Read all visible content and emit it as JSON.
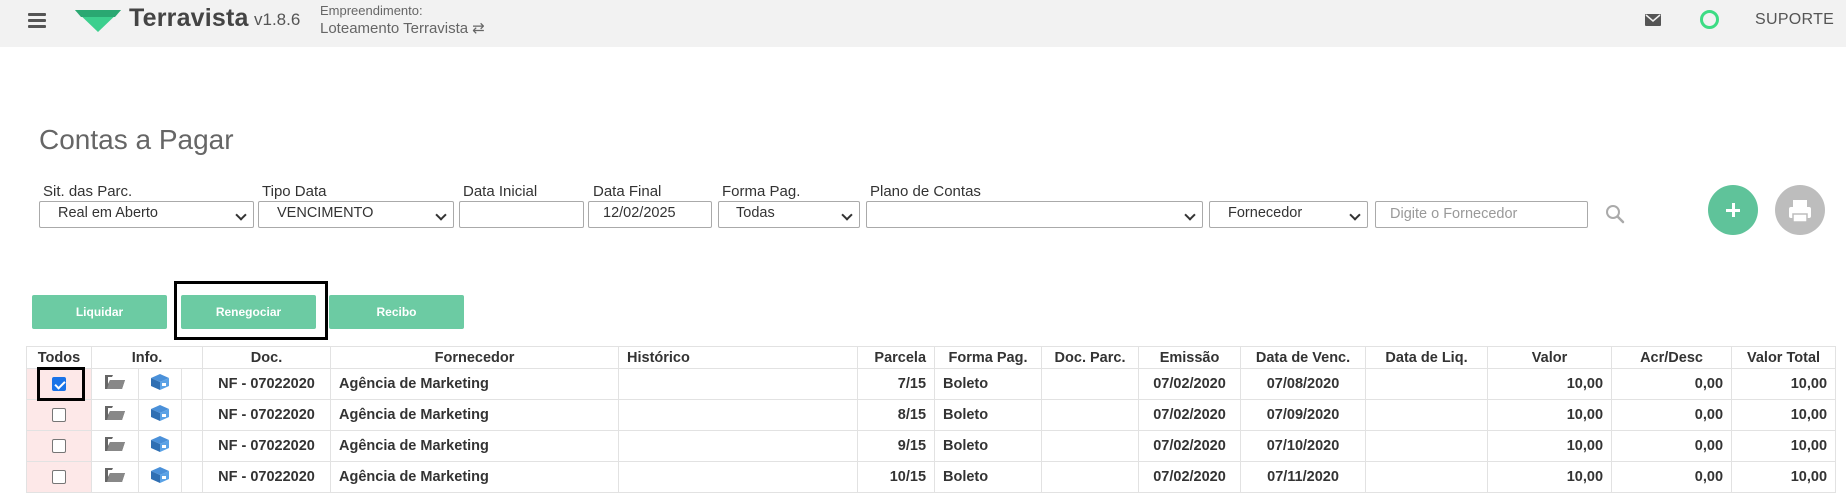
{
  "header": {
    "brand": "Terravista",
    "version": "v1.8.6",
    "empreendimento_label": "Empreendimento:",
    "empreendimento_value": "Loteamento Terravista ⇄",
    "support_label": "SUPORTE",
    "brand_color": "#3ccf8e"
  },
  "page": {
    "title": "Contas a Pagar"
  },
  "filters": {
    "situacao": {
      "label": "Sit. das Parc.",
      "value": "Real em Aberto"
    },
    "tipo_data": {
      "label": "Tipo Data",
      "value": "VENCIMENTO"
    },
    "data_inicial": {
      "label": "Data Inicial",
      "value": ""
    },
    "data_final": {
      "label": "Data Final",
      "value": "12/02/2025"
    },
    "forma_pag": {
      "label": "Forma Pag.",
      "value": "Todas"
    },
    "plano_contas": {
      "label": "Plano de Contas",
      "value": ""
    },
    "fornecedor_select": {
      "value": "Fornecedor"
    },
    "fornecedor_search": {
      "placeholder": "Digite o Fornecedor"
    }
  },
  "actions": {
    "liquidar": "Liquidar",
    "renegociar": "Renegociar",
    "recibo": "Recibo"
  },
  "table": {
    "headers": {
      "todos": "Todos",
      "info": "Info.",
      "doc": "Doc.",
      "fornecedor": "Fornecedor",
      "historico": "Histórico",
      "parcela": "Parcela",
      "forma_pag": "Forma Pag.",
      "doc_parc": "Doc. Parc.",
      "emissao": "Emissão",
      "data_venc": "Data de Venc.",
      "data_liq": "Data de Liq.",
      "valor": "Valor",
      "acr_desc": "Acr/Desc",
      "valor_total": "Valor Total"
    },
    "rows": [
      {
        "checked": true,
        "doc": "NF - 07022020",
        "fornecedor": "Agência de Marketing",
        "historico": "",
        "parcela": "7/15",
        "forma_pag": "Boleto",
        "doc_parc": "",
        "emissao": "07/02/2020",
        "venc": "07/08/2020",
        "liq": "",
        "valor": "10,00",
        "acr": "0,00",
        "total": "10,00"
      },
      {
        "checked": false,
        "doc": "NF - 07022020",
        "fornecedor": "Agência de Marketing",
        "historico": "",
        "parcela": "8/15",
        "forma_pag": "Boleto",
        "doc_parc": "",
        "emissao": "07/02/2020",
        "venc": "07/09/2020",
        "liq": "",
        "valor": "10,00",
        "acr": "0,00",
        "total": "10,00"
      },
      {
        "checked": false,
        "doc": "NF - 07022020",
        "fornecedor": "Agência de Marketing",
        "historico": "",
        "parcela": "9/15",
        "forma_pag": "Boleto",
        "doc_parc": "",
        "emissao": "07/02/2020",
        "venc": "07/10/2020",
        "liq": "",
        "valor": "10,00",
        "acr": "0,00",
        "total": "10,00"
      },
      {
        "checked": false,
        "doc": "NF - 07022020",
        "fornecedor": "Agência de Marketing",
        "historico": "",
        "parcela": "10/15",
        "forma_pag": "Boleto",
        "doc_parc": "",
        "emissao": "07/02/2020",
        "venc": "07/11/2020",
        "liq": "",
        "valor": "10,00",
        "acr": "0,00",
        "total": "10,00"
      }
    ]
  }
}
